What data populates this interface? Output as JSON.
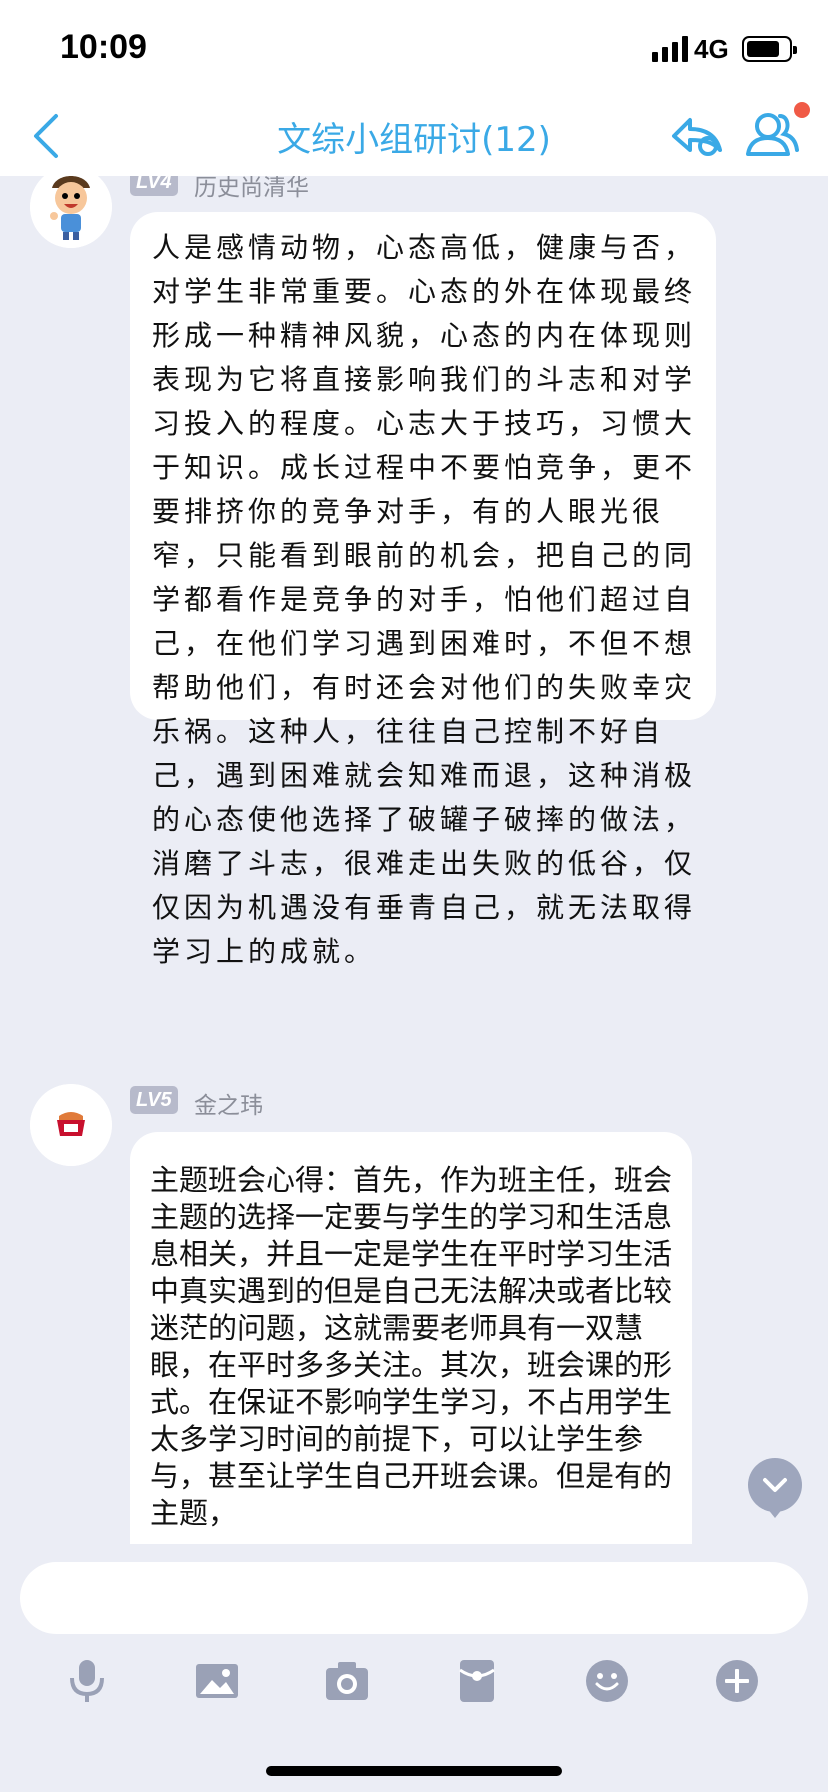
{
  "status_bar": {
    "time": "10:09",
    "network": "4G"
  },
  "nav": {
    "title": "文综小组研讨(12)",
    "accent_color": "#3aa9e6",
    "icons": [
      "back-icon",
      "share-icon",
      "group-members-icon"
    ]
  },
  "messages": [
    {
      "level": "LV4",
      "sender": "历史尚清华",
      "text": "人是感情动物，心态高低，健康与否，对学生非常重要。心态的外在体现最终形成一种精神风貌，心态的内在体现则表现为它将直接影响我们的斗志和对学习投入的程度。心志大于技巧，习惯大于知识。成长过程中不要怕竞争，更不要排挤你的竞争对手，有的人眼光很窄，只能看到眼前的机会，把自己的同学都看作是竞争的对手，怕他们超过自己，在他们学习遇到困难时，不但不想帮助他们，有时还会对他们的失败幸灾乐祸。这种人，往往自己控制不好自己，遇到困难就会知难而退，这种消极的心态使他选择了破罐子破摔的做法，消磨了斗志，很难走出失败的低谷，仅仅因为机遇没有垂青自己，就无法取得学习上的成就。"
    },
    {
      "level": "LV5",
      "sender": "金之玮",
      "text": "主题班会心得：首先，作为班主任，班会主题的选择一定要与学生的学习和生活息息相关，并且一定是学生在平时学习生活中真实遇到的但是自己无法解决或者比较迷茫的问题，这就需要老师具有一双慧眼，在平时多多关注。其次，班会课的形式。在保证不影响学生学习，不占用学生太多学习时间的前提下，可以让学生参与，甚至让学生自己开班会课。但是有的主题，"
    }
  ],
  "input": {
    "placeholder": ""
  },
  "toolbar": {
    "icons": [
      "microphone-icon",
      "image-icon",
      "camera-icon",
      "red-packet-icon",
      "emoji-icon",
      "add-icon"
    ]
  }
}
